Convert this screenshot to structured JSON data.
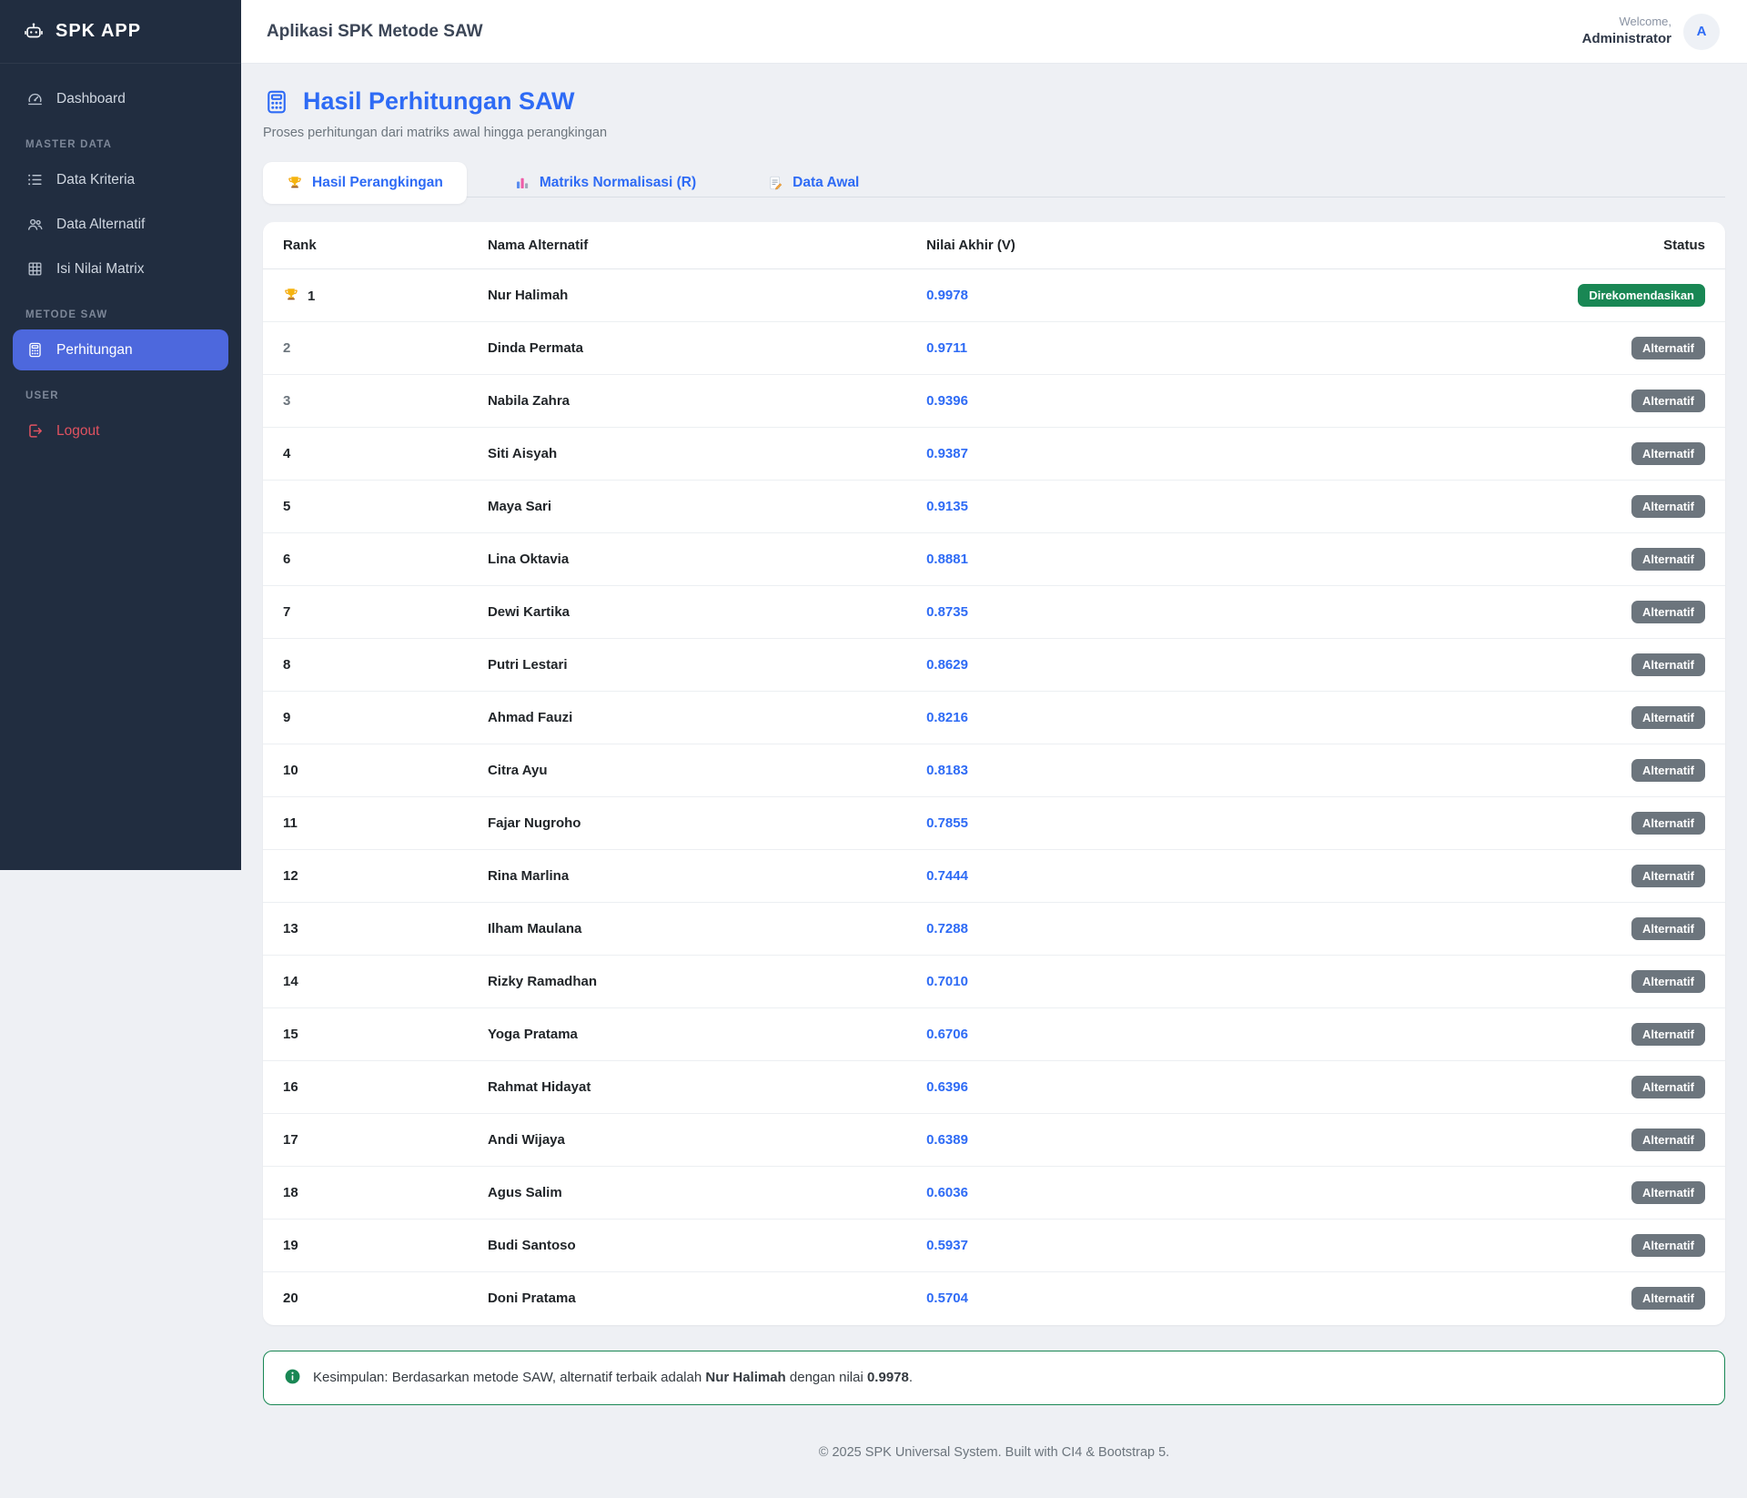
{
  "sidebar": {
    "brand": "SPK APP",
    "sections": [
      {
        "label": "",
        "items": [
          {
            "label": "Dashboard",
            "icon": "dashboard"
          }
        ]
      },
      {
        "label": "MASTER DATA",
        "items": [
          {
            "label": "Data Kriteria",
            "icon": "list"
          },
          {
            "label": "Data Alternatif",
            "icon": "users"
          },
          {
            "label": "Isi Nilai Matrix",
            "icon": "grid"
          }
        ]
      },
      {
        "label": "METODE SAW",
        "items": [
          {
            "label": "Perhitungan",
            "icon": "calculator",
            "active": true
          }
        ]
      },
      {
        "label": "USER",
        "items": [
          {
            "label": "Logout",
            "icon": "logout",
            "danger": true
          }
        ]
      }
    ]
  },
  "header": {
    "app_title": "Aplikasi SPK Metode SAW",
    "welcome": "Welcome,",
    "username": "Administrator",
    "avatar_letter": "A"
  },
  "page": {
    "title": "Hasil Perhitungan SAW",
    "subtitle": "Proses perhitungan dari matriks awal hingga perangkingan"
  },
  "tabs": [
    {
      "label": "Hasil Perangkingan",
      "icon": "trophy",
      "active": true
    },
    {
      "label": "Matriks Normalisasi (R)",
      "icon": "bar-chart",
      "active": false
    },
    {
      "label": "Data Awal",
      "icon": "memo",
      "active": false
    }
  ],
  "table": {
    "columns": [
      "Rank",
      "Nama Alternatif",
      "Nilai Akhir (V)",
      "Status"
    ],
    "rows": [
      {
        "rank": 1,
        "name": "Nur Halimah",
        "value": "0.9978",
        "status": "Direkomendasikan",
        "recommended": true,
        "trophy": true
      },
      {
        "rank": 2,
        "name": "Dinda Permata",
        "value": "0.9711",
        "status": "Alternatif",
        "recommended": false,
        "muted": true
      },
      {
        "rank": 3,
        "name": "Nabila Zahra",
        "value": "0.9396",
        "status": "Alternatif",
        "recommended": false,
        "muted": true
      },
      {
        "rank": 4,
        "name": "Siti Aisyah",
        "value": "0.9387",
        "status": "Alternatif",
        "recommended": false
      },
      {
        "rank": 5,
        "name": "Maya Sari",
        "value": "0.9135",
        "status": "Alternatif",
        "recommended": false
      },
      {
        "rank": 6,
        "name": "Lina Oktavia",
        "value": "0.8881",
        "status": "Alternatif",
        "recommended": false
      },
      {
        "rank": 7,
        "name": "Dewi Kartika",
        "value": "0.8735",
        "status": "Alternatif",
        "recommended": false
      },
      {
        "rank": 8,
        "name": "Putri Lestari",
        "value": "0.8629",
        "status": "Alternatif",
        "recommended": false
      },
      {
        "rank": 9,
        "name": "Ahmad Fauzi",
        "value": "0.8216",
        "status": "Alternatif",
        "recommended": false
      },
      {
        "rank": 10,
        "name": "Citra Ayu",
        "value": "0.8183",
        "status": "Alternatif",
        "recommended": false
      },
      {
        "rank": 11,
        "name": "Fajar Nugroho",
        "value": "0.7855",
        "status": "Alternatif",
        "recommended": false
      },
      {
        "rank": 12,
        "name": "Rina Marlina",
        "value": "0.7444",
        "status": "Alternatif",
        "recommended": false
      },
      {
        "rank": 13,
        "name": "Ilham Maulana",
        "value": "0.7288",
        "status": "Alternatif",
        "recommended": false
      },
      {
        "rank": 14,
        "name": "Rizky Ramadhan",
        "value": "0.7010",
        "status": "Alternatif",
        "recommended": false
      },
      {
        "rank": 15,
        "name": "Yoga Pratama",
        "value": "0.6706",
        "status": "Alternatif",
        "recommended": false
      },
      {
        "rank": 16,
        "name": "Rahmat Hidayat",
        "value": "0.6396",
        "status": "Alternatif",
        "recommended": false
      },
      {
        "rank": 17,
        "name": "Andi Wijaya",
        "value": "0.6389",
        "status": "Alternatif",
        "recommended": false
      },
      {
        "rank": 18,
        "name": "Agus Salim",
        "value": "0.6036",
        "status": "Alternatif",
        "recommended": false
      },
      {
        "rank": 19,
        "name": "Budi Santoso",
        "value": "0.5937",
        "status": "Alternatif",
        "recommended": false
      },
      {
        "rank": 20,
        "name": "Doni Pratama",
        "value": "0.5704",
        "status": "Alternatif",
        "recommended": false
      }
    ]
  },
  "conclusion": {
    "prefix": "Kesimpulan: Berdasarkan metode SAW, alternatif terbaik adalah",
    "name": "Nur Halimah",
    "middle": "dengan nilai",
    "value": "0.9978",
    "suffix": "."
  },
  "footer": {
    "text": "© 2025 SPK Universal System. Built with CI4 & Bootstrap 5."
  },
  "colors": {
    "accent_blue": "#2e6bf5",
    "sidebar_bg": "#212d40",
    "active_item": "#4d68dd",
    "danger_red": "#e05260",
    "success_green": "#198754",
    "badge_gray": "#6c757d"
  }
}
